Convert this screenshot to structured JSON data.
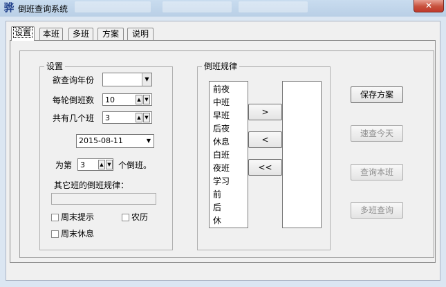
{
  "window": {
    "title": "倒班查询系统",
    "app_icon": "骅",
    "close_label": "✕"
  },
  "tabs": [
    {
      "label": "设置",
      "active": true
    },
    {
      "label": "本班"
    },
    {
      "label": "多班"
    },
    {
      "label": "方案"
    },
    {
      "label": "说明"
    }
  ],
  "settings": {
    "legend": "设置",
    "year_label": "欲查询年份",
    "year_value": "",
    "cycle_label": "每轮倒班数",
    "cycle_value": "10",
    "shifts_label": "共有几个班",
    "shifts_value": "3",
    "date_value": "2015-08-11",
    "as_prefix": "为第",
    "as_value": "3",
    "as_suffix": "个倒班。",
    "other_rule_label": "其它班的倒班规律：",
    "other_rule_value": "",
    "weekend_hint": "周末提示",
    "lunar": "农历",
    "weekend_rest": "周末休息"
  },
  "rules": {
    "legend": "倒班规律",
    "items": [
      "前夜",
      "中班",
      "早班",
      "后夜",
      "休息",
      "白班",
      "夜班",
      "学习",
      "前",
      "后",
      "休"
    ],
    "add_label": ">",
    "remove_label": "<",
    "clear_label": "<<"
  },
  "actions": {
    "save": "保存方案",
    "today": "速查今天",
    "query_shift": "查询本班",
    "multi_query": "多班查询"
  }
}
